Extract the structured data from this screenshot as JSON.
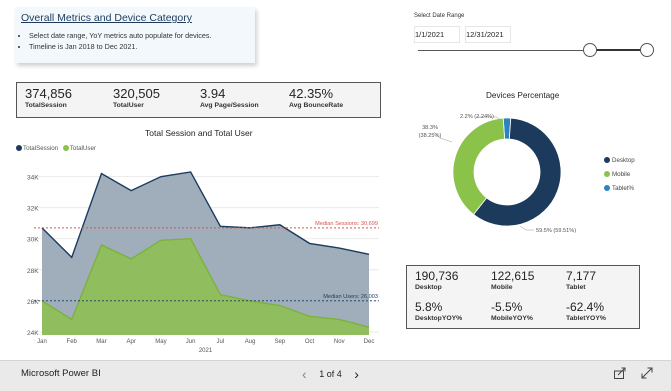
{
  "info_card": {
    "title": "Overall Metrics and Device Category",
    "bullets": [
      "Select date range, YoY metrics auto populate for devices.",
      "Timeline is Jan 2018 to Dec 2021."
    ]
  },
  "date_range": {
    "label": "Select Date Range",
    "start": "1/1/2021",
    "end": "12/31/2021"
  },
  "kpis": [
    {
      "value": "374,856",
      "label": "TotalSession"
    },
    {
      "value": "320,505",
      "label": "TotalUser"
    },
    {
      "value": "3.94",
      "label": "Avg Page/Session"
    },
    {
      "value": "42.35%",
      "label": "Avg BounceRate"
    }
  ],
  "line_chart_title": "Total Session and Total User",
  "legend": [
    {
      "name": "TotalSession",
      "color": "#1b3a5c"
    },
    {
      "name": "TotalUser",
      "color": "#8bc34a"
    }
  ],
  "reference_lines": {
    "median_sessions": "Median Sessions: 30,699",
    "median_users": "Median Users: 26,003"
  },
  "chart_data": {
    "type": "area",
    "title": "Total Session and Total User",
    "x": [
      "Jan",
      "Feb",
      "Mar",
      "Apr",
      "May",
      "Jun",
      "Jul",
      "Aug",
      "Sep",
      "Oct",
      "Nov",
      "Dec"
    ],
    "xlabel": "2021",
    "ylabel": "",
    "ylim": [
      23800,
      35200
    ],
    "yticks": [
      "24K",
      "26K",
      "28K",
      "30K",
      "32K",
      "34K"
    ],
    "ytick_values": [
      24000,
      26000,
      28000,
      30000,
      32000,
      34000
    ],
    "series": [
      {
        "name": "TotalSession",
        "color": "#9aaab6",
        "line": "#1b3a5c",
        "values": [
          30700,
          28800,
          34200,
          33100,
          34000,
          34300,
          30800,
          30700,
          30900,
          29700,
          29400,
          29000
        ]
      },
      {
        "name": "TotalUser",
        "color": "#8fbf5a",
        "line": "#7cb23a",
        "values": [
          26000,
          24800,
          29600,
          28700,
          29900,
          30000,
          26400,
          26000,
          25700,
          25000,
          24800,
          24300
        ]
      }
    ],
    "reference_lines": [
      {
        "label": "Median Sessions: 30,699",
        "value": 30699,
        "color": "#d9534f"
      },
      {
        "label": "Median Users: 26,003",
        "value": 26003,
        "color": "#1b3a5c"
      }
    ]
  },
  "donut": {
    "title": "Devices Percentage",
    "slices": [
      {
        "name": "Desktop",
        "pct": 59.51,
        "color": "#1b3a5c"
      },
      {
        "name": "Mobile",
        "pct": 38.25,
        "color": "#8bc34a"
      },
      {
        "name": "Tablet%",
        "pct": 2.24,
        "color": "#2b83c2"
      }
    ],
    "labels": {
      "tablet": "2.2% (2.24%)",
      "mobile_a": "38.3%",
      "mobile_b": "(38.25%)",
      "desktop": "59.5% (59.51%)"
    }
  },
  "devices": {
    "desktop_value": "190,736",
    "desktop_label": "Desktop",
    "mobile_value": "122,615",
    "mobile_label": "Mobile",
    "tablet_value": "7,177",
    "tablet_label": "Tablet",
    "desktop_yoy": "5.8%",
    "desktop_yoy_label": "DesktopYOY%",
    "mobile_yoy": "-5.5%",
    "mobile_yoy_label": "MobileYOY%",
    "tablet_yoy": "-62.4%",
    "tablet_yoy_label": "TabletYOY%"
  },
  "footer": {
    "brand": "Microsoft Power BI",
    "page": "1 of 4",
    "prev": "‹",
    "next": "›",
    "share_icon": "share-icon",
    "expand_icon": "expand-icon"
  }
}
